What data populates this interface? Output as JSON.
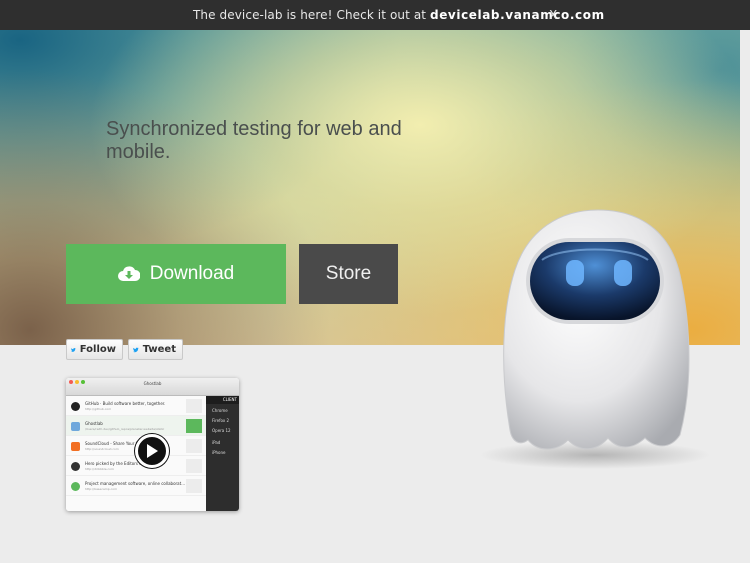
{
  "banner": {
    "message": "The device-lab is here! Check it out at ",
    "link": "devicelab.vanamco.com",
    "close": "X"
  },
  "hero": {
    "headline": "Synchronized testing for web and mobile.",
    "download_label": "Download",
    "store_label": "Store"
  },
  "social": {
    "follow_label": "Follow",
    "tweet_label": "Tweet"
  },
  "video": {
    "window_title": "Ghostlab",
    "sidebar_header": "CLIENT",
    "sites": [
      {
        "title": "GitHub · Build software better, together.",
        "url": "http://github.com",
        "color": "#222222"
      },
      {
        "title": "Ghostlab",
        "url": "/Users/redh.dev/github_repos/planeter.website/static",
        "color": "#6fa8dc"
      },
      {
        "title": "SoundCloud - Share Your Sounds",
        "url": "http://soundcloud.com",
        "color": "#f26f23"
      },
      {
        "title": "Hero picked by the Editors at Dribbble",
        "url": "http://dribbble.com",
        "color": "#333333"
      },
      {
        "title": "Project management software, online collaborat...",
        "url": "http://basecamp.com",
        "color": "#5cb85c"
      }
    ],
    "clients": [
      "Chrome",
      "Firefox 2",
      "Opera 12",
      "iPad",
      "iPhone"
    ]
  },
  "colors": {
    "topbar": "#2f2f2f",
    "download": "#5cb85c",
    "store": "#4a4a4a",
    "twitter": "#1da1f2"
  },
  "icons": {
    "download": "cloud-download-icon",
    "twitter": "twitter-bird-icon",
    "play": "play-icon",
    "mascot": "ghost-mascot"
  }
}
